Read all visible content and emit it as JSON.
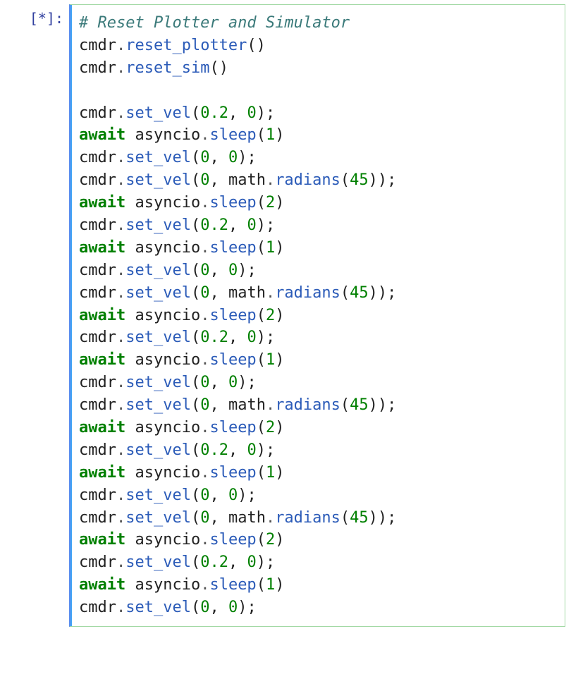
{
  "cell": {
    "prompt": "[*]:",
    "code_lines": [
      [
        {
          "t": "comment",
          "v": "# Reset Plotter and Simulator"
        }
      ],
      [
        {
          "t": "name",
          "v": "cmdr"
        },
        {
          "t": "op",
          "v": "."
        },
        {
          "t": "call",
          "v": "reset_plotter"
        },
        {
          "t": "punc",
          "v": "()"
        }
      ],
      [
        {
          "t": "name",
          "v": "cmdr"
        },
        {
          "t": "op",
          "v": "."
        },
        {
          "t": "call",
          "v": "reset_sim"
        },
        {
          "t": "punc",
          "v": "()"
        }
      ],
      [],
      [
        {
          "t": "name",
          "v": "cmdr"
        },
        {
          "t": "op",
          "v": "."
        },
        {
          "t": "call",
          "v": "set_vel"
        },
        {
          "t": "punc",
          "v": "("
        },
        {
          "t": "num",
          "v": "0.2"
        },
        {
          "t": "punc",
          "v": ", "
        },
        {
          "t": "num",
          "v": "0"
        },
        {
          "t": "punc",
          "v": ");"
        }
      ],
      [
        {
          "t": "kw",
          "v": "await"
        },
        {
          "t": "name",
          "v": " asyncio"
        },
        {
          "t": "op",
          "v": "."
        },
        {
          "t": "call",
          "v": "sleep"
        },
        {
          "t": "punc",
          "v": "("
        },
        {
          "t": "num",
          "v": "1"
        },
        {
          "t": "punc",
          "v": ")"
        }
      ],
      [
        {
          "t": "name",
          "v": "cmdr"
        },
        {
          "t": "op",
          "v": "."
        },
        {
          "t": "call",
          "v": "set_vel"
        },
        {
          "t": "punc",
          "v": "("
        },
        {
          "t": "num",
          "v": "0"
        },
        {
          "t": "punc",
          "v": ", "
        },
        {
          "t": "num",
          "v": "0"
        },
        {
          "t": "punc",
          "v": ");"
        }
      ],
      [
        {
          "t": "name",
          "v": "cmdr"
        },
        {
          "t": "op",
          "v": "."
        },
        {
          "t": "call",
          "v": "set_vel"
        },
        {
          "t": "punc",
          "v": "("
        },
        {
          "t": "num",
          "v": "0"
        },
        {
          "t": "punc",
          "v": ", "
        },
        {
          "t": "name",
          "v": "math"
        },
        {
          "t": "op",
          "v": "."
        },
        {
          "t": "call",
          "v": "radians"
        },
        {
          "t": "punc",
          "v": "("
        },
        {
          "t": "num",
          "v": "45"
        },
        {
          "t": "punc",
          "v": "));"
        }
      ],
      [
        {
          "t": "kw",
          "v": "await"
        },
        {
          "t": "name",
          "v": " asyncio"
        },
        {
          "t": "op",
          "v": "."
        },
        {
          "t": "call",
          "v": "sleep"
        },
        {
          "t": "punc",
          "v": "("
        },
        {
          "t": "num",
          "v": "2"
        },
        {
          "t": "punc",
          "v": ")"
        }
      ],
      [
        {
          "t": "name",
          "v": "cmdr"
        },
        {
          "t": "op",
          "v": "."
        },
        {
          "t": "call",
          "v": "set_vel"
        },
        {
          "t": "punc",
          "v": "("
        },
        {
          "t": "num",
          "v": "0.2"
        },
        {
          "t": "punc",
          "v": ", "
        },
        {
          "t": "num",
          "v": "0"
        },
        {
          "t": "punc",
          "v": ");"
        }
      ],
      [
        {
          "t": "kw",
          "v": "await"
        },
        {
          "t": "name",
          "v": " asyncio"
        },
        {
          "t": "op",
          "v": "."
        },
        {
          "t": "call",
          "v": "sleep"
        },
        {
          "t": "punc",
          "v": "("
        },
        {
          "t": "num",
          "v": "1"
        },
        {
          "t": "punc",
          "v": ")"
        }
      ],
      [
        {
          "t": "name",
          "v": "cmdr"
        },
        {
          "t": "op",
          "v": "."
        },
        {
          "t": "call",
          "v": "set_vel"
        },
        {
          "t": "punc",
          "v": "("
        },
        {
          "t": "num",
          "v": "0"
        },
        {
          "t": "punc",
          "v": ", "
        },
        {
          "t": "num",
          "v": "0"
        },
        {
          "t": "punc",
          "v": ");"
        }
      ],
      [
        {
          "t": "name",
          "v": "cmdr"
        },
        {
          "t": "op",
          "v": "."
        },
        {
          "t": "call",
          "v": "set_vel"
        },
        {
          "t": "punc",
          "v": "("
        },
        {
          "t": "num",
          "v": "0"
        },
        {
          "t": "punc",
          "v": ", "
        },
        {
          "t": "name",
          "v": "math"
        },
        {
          "t": "op",
          "v": "."
        },
        {
          "t": "call",
          "v": "radians"
        },
        {
          "t": "punc",
          "v": "("
        },
        {
          "t": "num",
          "v": "45"
        },
        {
          "t": "punc",
          "v": "));"
        }
      ],
      [
        {
          "t": "kw",
          "v": "await"
        },
        {
          "t": "name",
          "v": " asyncio"
        },
        {
          "t": "op",
          "v": "."
        },
        {
          "t": "call",
          "v": "sleep"
        },
        {
          "t": "punc",
          "v": "("
        },
        {
          "t": "num",
          "v": "2"
        },
        {
          "t": "punc",
          "v": ")"
        }
      ],
      [
        {
          "t": "name",
          "v": "cmdr"
        },
        {
          "t": "op",
          "v": "."
        },
        {
          "t": "call",
          "v": "set_vel"
        },
        {
          "t": "punc",
          "v": "("
        },
        {
          "t": "num",
          "v": "0.2"
        },
        {
          "t": "punc",
          "v": ", "
        },
        {
          "t": "num",
          "v": "0"
        },
        {
          "t": "punc",
          "v": ");"
        }
      ],
      [
        {
          "t": "kw",
          "v": "await"
        },
        {
          "t": "name",
          "v": " asyncio"
        },
        {
          "t": "op",
          "v": "."
        },
        {
          "t": "call",
          "v": "sleep"
        },
        {
          "t": "punc",
          "v": "("
        },
        {
          "t": "num",
          "v": "1"
        },
        {
          "t": "punc",
          "v": ")"
        }
      ],
      [
        {
          "t": "name",
          "v": "cmdr"
        },
        {
          "t": "op",
          "v": "."
        },
        {
          "t": "call",
          "v": "set_vel"
        },
        {
          "t": "punc",
          "v": "("
        },
        {
          "t": "num",
          "v": "0"
        },
        {
          "t": "punc",
          "v": ", "
        },
        {
          "t": "num",
          "v": "0"
        },
        {
          "t": "punc",
          "v": ");"
        }
      ],
      [
        {
          "t": "name",
          "v": "cmdr"
        },
        {
          "t": "op",
          "v": "."
        },
        {
          "t": "call",
          "v": "set_vel"
        },
        {
          "t": "punc",
          "v": "("
        },
        {
          "t": "num",
          "v": "0"
        },
        {
          "t": "punc",
          "v": ", "
        },
        {
          "t": "name",
          "v": "math"
        },
        {
          "t": "op",
          "v": "."
        },
        {
          "t": "call",
          "v": "radians"
        },
        {
          "t": "punc",
          "v": "("
        },
        {
          "t": "num",
          "v": "45"
        },
        {
          "t": "punc",
          "v": "));"
        }
      ],
      [
        {
          "t": "kw",
          "v": "await"
        },
        {
          "t": "name",
          "v": " asyncio"
        },
        {
          "t": "op",
          "v": "."
        },
        {
          "t": "call",
          "v": "sleep"
        },
        {
          "t": "punc",
          "v": "("
        },
        {
          "t": "num",
          "v": "2"
        },
        {
          "t": "punc",
          "v": ")"
        }
      ],
      [
        {
          "t": "name",
          "v": "cmdr"
        },
        {
          "t": "op",
          "v": "."
        },
        {
          "t": "call",
          "v": "set_vel"
        },
        {
          "t": "punc",
          "v": "("
        },
        {
          "t": "num",
          "v": "0.2"
        },
        {
          "t": "punc",
          "v": ", "
        },
        {
          "t": "num",
          "v": "0"
        },
        {
          "t": "punc",
          "v": ");"
        }
      ],
      [
        {
          "t": "kw",
          "v": "await"
        },
        {
          "t": "name",
          "v": " asyncio"
        },
        {
          "t": "op",
          "v": "."
        },
        {
          "t": "call",
          "v": "sleep"
        },
        {
          "t": "punc",
          "v": "("
        },
        {
          "t": "num",
          "v": "1"
        },
        {
          "t": "punc",
          "v": ")"
        }
      ],
      [
        {
          "t": "name",
          "v": "cmdr"
        },
        {
          "t": "op",
          "v": "."
        },
        {
          "t": "call",
          "v": "set_vel"
        },
        {
          "t": "punc",
          "v": "("
        },
        {
          "t": "num",
          "v": "0"
        },
        {
          "t": "punc",
          "v": ", "
        },
        {
          "t": "num",
          "v": "0"
        },
        {
          "t": "punc",
          "v": ");"
        }
      ],
      [
        {
          "t": "name",
          "v": "cmdr"
        },
        {
          "t": "op",
          "v": "."
        },
        {
          "t": "call",
          "v": "set_vel"
        },
        {
          "t": "punc",
          "v": "("
        },
        {
          "t": "num",
          "v": "0"
        },
        {
          "t": "punc",
          "v": ", "
        },
        {
          "t": "name",
          "v": "math"
        },
        {
          "t": "op",
          "v": "."
        },
        {
          "t": "call",
          "v": "radians"
        },
        {
          "t": "punc",
          "v": "("
        },
        {
          "t": "num",
          "v": "45"
        },
        {
          "t": "punc",
          "v": "));"
        }
      ],
      [
        {
          "t": "kw",
          "v": "await"
        },
        {
          "t": "name",
          "v": " asyncio"
        },
        {
          "t": "op",
          "v": "."
        },
        {
          "t": "call",
          "v": "sleep"
        },
        {
          "t": "punc",
          "v": "("
        },
        {
          "t": "num",
          "v": "2"
        },
        {
          "t": "punc",
          "v": ")"
        }
      ],
      [
        {
          "t": "name",
          "v": "cmdr"
        },
        {
          "t": "op",
          "v": "."
        },
        {
          "t": "call",
          "v": "set_vel"
        },
        {
          "t": "punc",
          "v": "("
        },
        {
          "t": "num",
          "v": "0.2"
        },
        {
          "t": "punc",
          "v": ", "
        },
        {
          "t": "num",
          "v": "0"
        },
        {
          "t": "punc",
          "v": ");"
        }
      ],
      [
        {
          "t": "kw",
          "v": "await"
        },
        {
          "t": "name",
          "v": " asyncio"
        },
        {
          "t": "op",
          "v": "."
        },
        {
          "t": "call",
          "v": "sleep"
        },
        {
          "t": "punc",
          "v": "("
        },
        {
          "t": "num",
          "v": "1"
        },
        {
          "t": "punc",
          "v": ")"
        }
      ],
      [
        {
          "t": "name",
          "v": "cmdr"
        },
        {
          "t": "op",
          "v": "."
        },
        {
          "t": "call",
          "v": "set_vel"
        },
        {
          "t": "punc",
          "v": "("
        },
        {
          "t": "num",
          "v": "0"
        },
        {
          "t": "punc",
          "v": ", "
        },
        {
          "t": "num",
          "v": "0"
        },
        {
          "t": "punc",
          "v": ");"
        }
      ]
    ]
  }
}
